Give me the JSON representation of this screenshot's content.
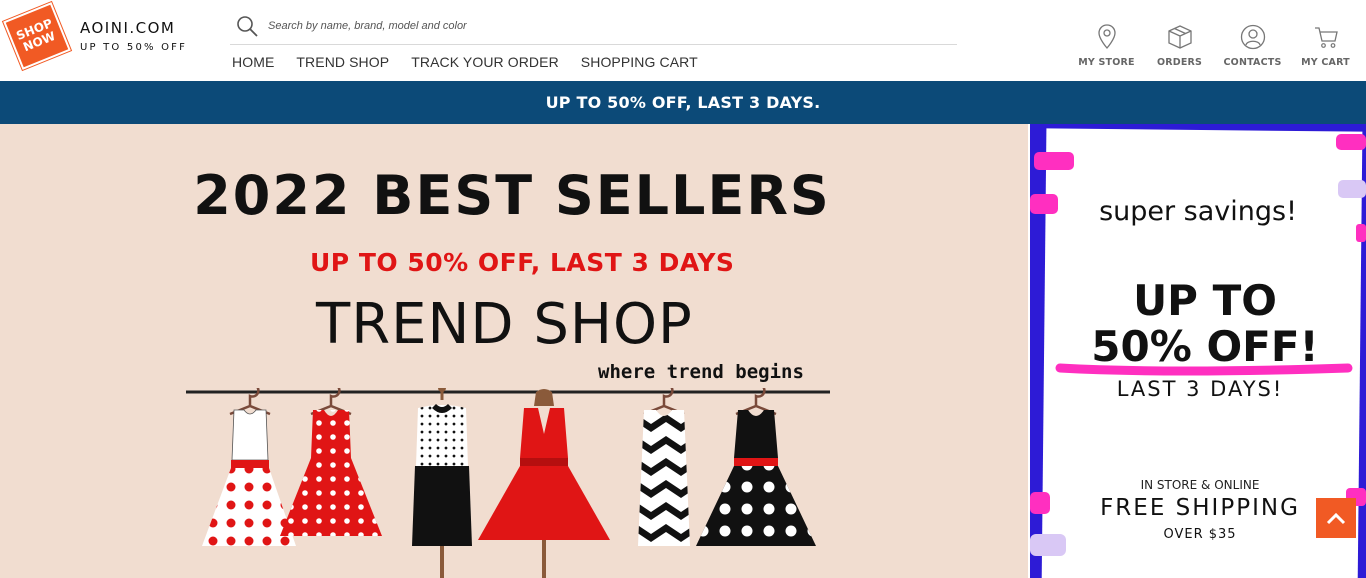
{
  "logo": {
    "badge_line1": "SHOP",
    "badge_line2": "NOW",
    "name": "AOINI.COM",
    "tagline": "UP TO 50% OFF"
  },
  "search": {
    "placeholder": "Search by name, brand, model and color",
    "icon": "search-icon"
  },
  "nav": [
    {
      "label": "HOME"
    },
    {
      "label": "TREND SHOP"
    },
    {
      "label": "TRACK YOUR ORDER"
    },
    {
      "label": "SHOPPING CART"
    }
  ],
  "utility": [
    {
      "label": "MY STORE",
      "icon": "map-pin-icon"
    },
    {
      "label": "ORDERS",
      "icon": "box-icon"
    },
    {
      "label": "CONTACTS",
      "icon": "user-icon"
    },
    {
      "label": "MY CART",
      "icon": "cart-icon"
    }
  ],
  "promo_bar": {
    "text": "UP TO 50% OFF, LAST 3 DAYS."
  },
  "main_banner": {
    "title": "2022 BEST SELLERS",
    "subtitle": "UP TO 50% OFF, LAST 3 DAYS",
    "shop_name": "TREND SHOP",
    "tagline": "where trend begins"
  },
  "side_banner": {
    "headline": "super savings!",
    "offer_line1": "UP TO",
    "offer_line2": "50% OFF!",
    "duration": "LAST 3 DAYS!",
    "channel": "IN STORE & ONLINE",
    "shipping": "FREE SHIPPING",
    "threshold": "OVER $35"
  },
  "colors": {
    "accent": "#f15a24",
    "promo_bar": "#0c4a78",
    "banner_bg": "#f1ddd0",
    "sale_red": "#e01515",
    "side_frame": "#2d1bd6",
    "highlight_pink": "#ff2fc0"
  },
  "back_to_top": {
    "icon": "chevron-up-icon"
  }
}
